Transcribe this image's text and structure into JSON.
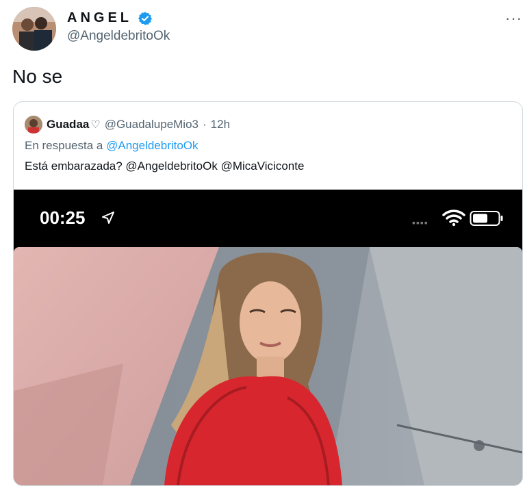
{
  "author": {
    "display_name": "ANGEL",
    "handle": "@AngeldebritoOk",
    "verified": true
  },
  "more_label": "···",
  "tweet": {
    "text": "No se"
  },
  "quoted": {
    "name": "Guadaa",
    "heart_symbol": "♡",
    "handle": "@GuadalupeMio3",
    "separator": "·",
    "time": "12h",
    "reply_prefix": "En respuesta a",
    "reply_mention": "@AngeldebritoOk",
    "text": "Está embarazada? @AngeldebritoOk @MicaViciconte",
    "screenshot": {
      "clock": "00:25",
      "signal_dots": "▪▪▪▪",
      "icons": [
        "location-arrow-icon",
        "wifi-icon",
        "battery-icon"
      ]
    }
  },
  "colors": {
    "accent": "#1d9bf0",
    "secondary_text": "#536471",
    "primary_text": "#0f1419",
    "sweater": "#d8262e"
  }
}
